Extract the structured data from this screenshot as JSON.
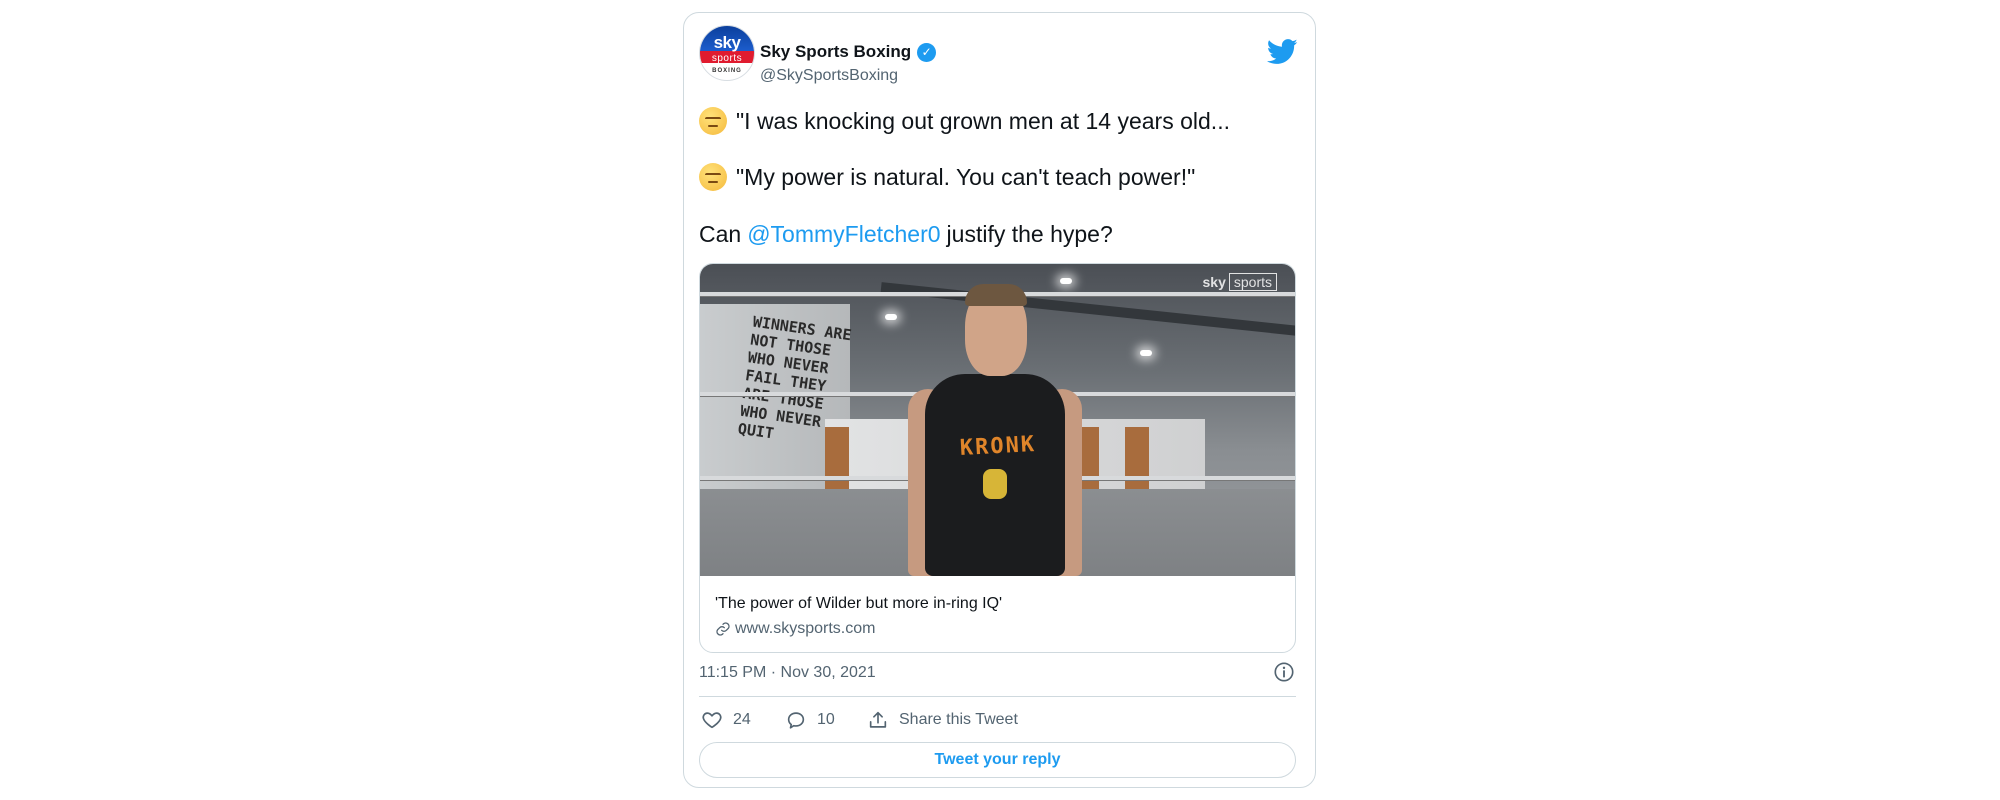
{
  "author": {
    "display_name": "Sky Sports Boxing",
    "handle": "@SkySportsBoxing",
    "avatar_logo": {
      "line1": "sky",
      "line2": "sports",
      "line3": "BOXING"
    },
    "verified_icon": "verified-badge-icon"
  },
  "brand_icon": "twitter-bird-icon",
  "tweet": {
    "lines": [
      {
        "emoji": "unamused-face-emoji",
        "text": "\"I was knocking out grown men at 14 years old..."
      },
      {
        "emoji": "unamused-face-emoji",
        "text": "\"My power is natural. You can't teach power!\""
      }
    ],
    "closing": {
      "prefix": "Can",
      "mention": "@TommyFletcher0",
      "suffix": "justify the hype?"
    }
  },
  "link_card": {
    "image": {
      "watermark_sky": "sky",
      "watermark_sports": "sports",
      "shirt_text": "KRONK",
      "wall_text": "WINNERS ARE NOT THOSE WHO NEVER FAIL THEY ARE THOSE WHO NEVER QUIT"
    },
    "title": "'The power of Wilder but more in-ring IQ'",
    "domain": "www.skysports.com"
  },
  "timestamp": "11:15 PM · Nov 30, 2021",
  "actions": {
    "like_count": "24",
    "reply_count": "10",
    "share_label": "Share this Tweet"
  },
  "reply_button_label": "Tweet your reply",
  "colors": {
    "twitter_blue": "#1d9bf0",
    "text_primary": "#0f1419",
    "text_secondary": "#536471",
    "border": "#cfd9de"
  }
}
